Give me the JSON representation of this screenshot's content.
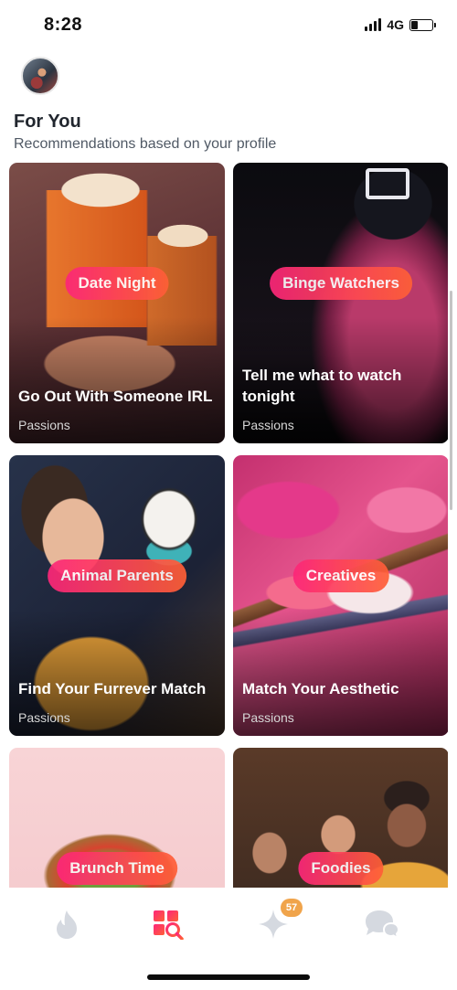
{
  "status_bar": {
    "time": "8:28",
    "network": "4G"
  },
  "header": {
    "title": "For You",
    "subtitle": "Recommendations based on your profile"
  },
  "cards": [
    {
      "tag": "Date Night",
      "title": "Go Out With Someone IRL",
      "category": "Passions"
    },
    {
      "tag": "Binge Watchers",
      "title": "Tell me what to watch tonight",
      "category": "Passions"
    },
    {
      "tag": "Animal Parents",
      "title": "Find Your Furrever Match",
      "category": "Passions"
    },
    {
      "tag": "Creatives",
      "title": "Match Your Aesthetic",
      "category": "Passions"
    },
    {
      "tag": "Brunch Time",
      "title": "",
      "category": ""
    },
    {
      "tag": "Foodies",
      "title": "",
      "category": ""
    }
  ],
  "tab_bar": {
    "tabs": [
      {
        "icon": "flame-icon",
        "active": false
      },
      {
        "icon": "explore-grid-icon",
        "active": true
      },
      {
        "icon": "sparkle-icon",
        "active": false
      },
      {
        "icon": "chat-bubbles-icon",
        "active": false
      }
    ],
    "badge_count": "57"
  },
  "colors": {
    "accent_gradient_start": "#fd267a",
    "accent_gradient_end": "#ff6036",
    "inactive_icon": "#d5d9e0",
    "badge": "#f0a44b"
  }
}
